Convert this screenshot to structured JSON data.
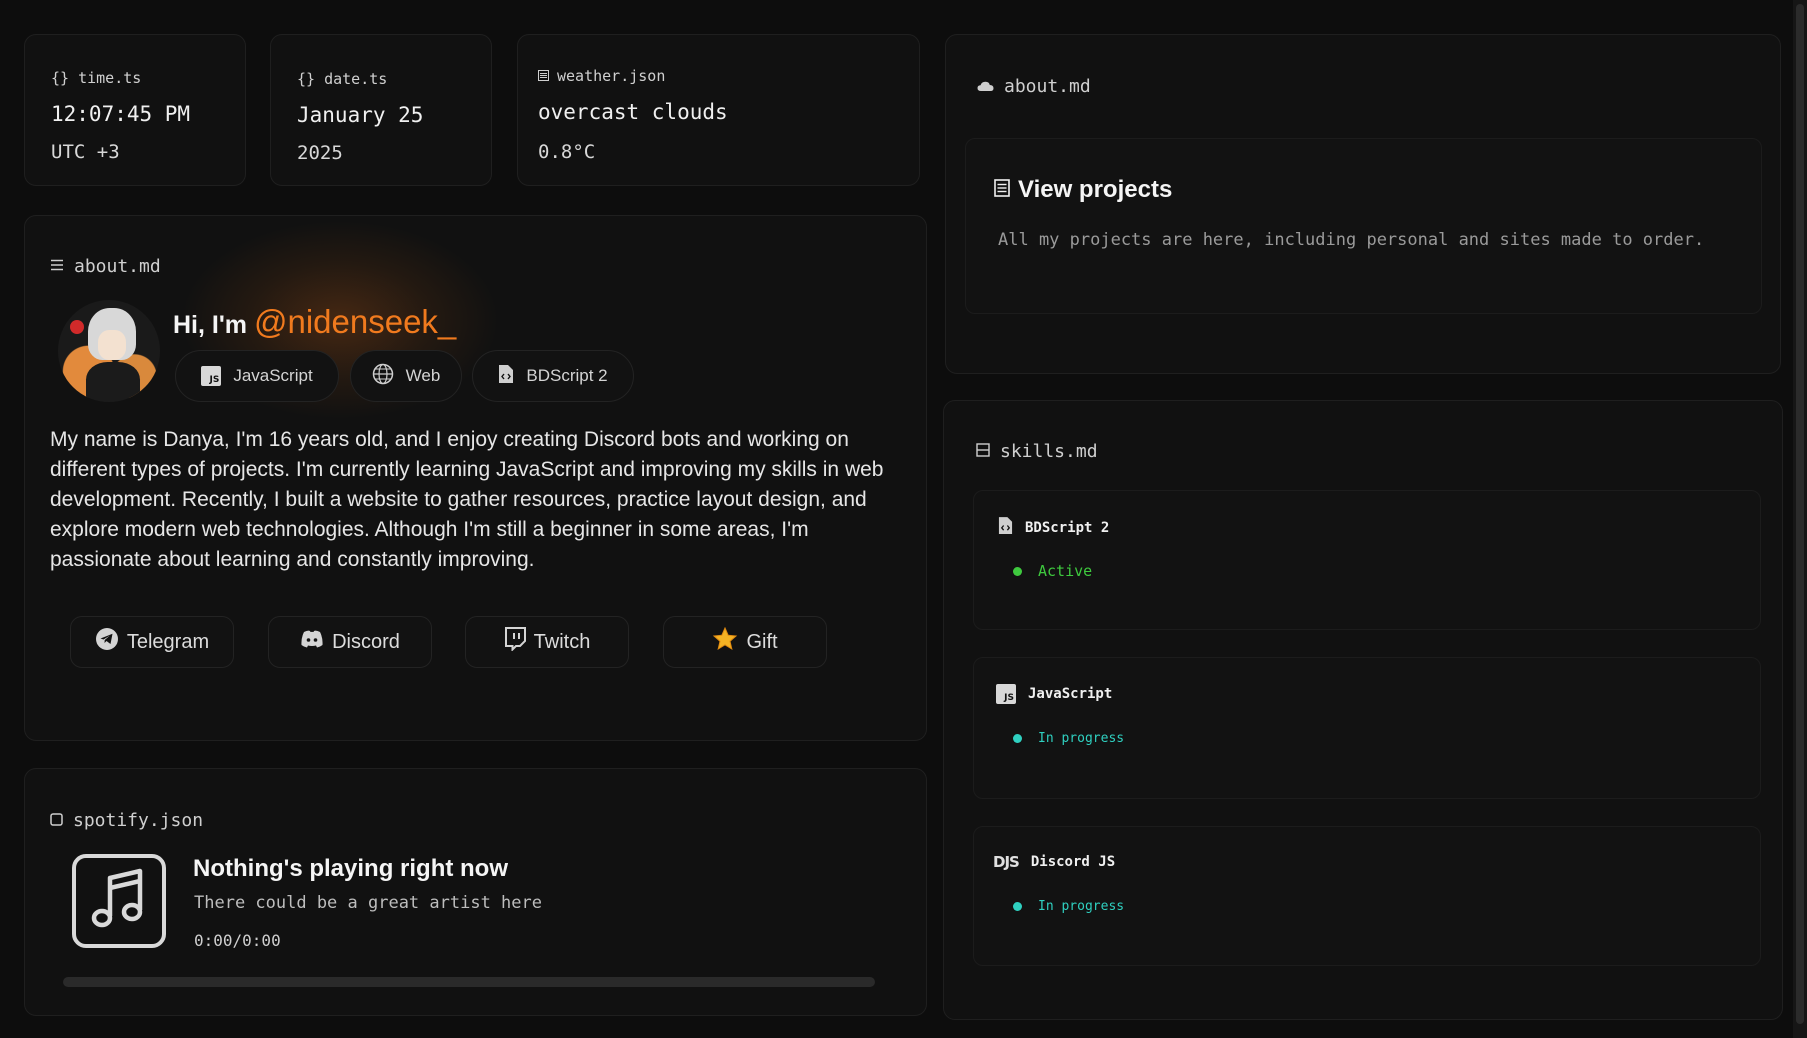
{
  "widgets": {
    "time": {
      "file": "time.ts",
      "value": "12:07:45 PM",
      "sub": "UTC +3"
    },
    "date": {
      "file": "date.ts",
      "value": "January 25",
      "sub": "2025"
    },
    "weather": {
      "file": "weather.json",
      "value": "overcast clouds",
      "sub": "0.8°C"
    }
  },
  "about": {
    "file": "about.md",
    "greeting": "Hi, I'm",
    "handle": "@nidenseek",
    "cursor": "_",
    "tags": [
      "JavaScript",
      "Web",
      "BDScript 2"
    ],
    "bio": "My name is Danya, I'm 16 years old, and I enjoy creating Discord bots and working on different types of projects. I'm currently learning JavaScript and improving my skills in web development. Recently, I built a website to gather resources, practice layout design, and explore modern web technologies. Although I'm still a beginner in some areas, I'm passionate about learning and constantly improving.",
    "socials": [
      "Telegram",
      "Discord",
      "Twitch",
      "Gift"
    ]
  },
  "spotify": {
    "file": "spotify.json",
    "title": "Nothing's playing right now",
    "subtitle": "There could be a great artist here",
    "time": "0:00/0:00",
    "progress": 0
  },
  "projects": {
    "file": "about.md",
    "title": "View projects",
    "description": "All my projects are here, including personal and sites made to order."
  },
  "skills": {
    "file": "skills.md",
    "items": [
      {
        "name": "BDScript 2",
        "status": "Active",
        "color": "#3ec93e"
      },
      {
        "name": "JavaScript",
        "status": "In progress",
        "color": "#2fd0c0"
      },
      {
        "name": "Discord JS",
        "status": "In progress",
        "color": "#2fd0c0"
      }
    ]
  },
  "colors": {
    "accent": "#f07a1e",
    "background": "#0d0d0d",
    "card": "#111111"
  }
}
